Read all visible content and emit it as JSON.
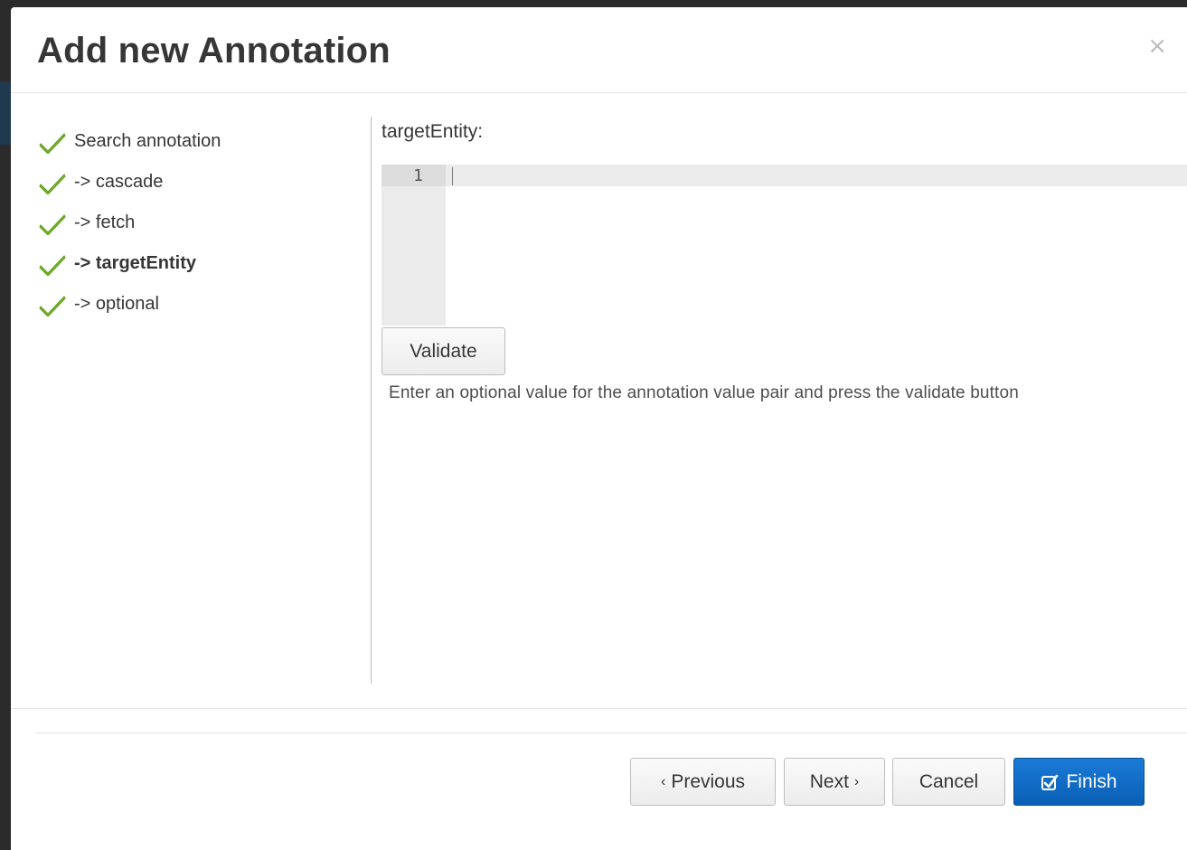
{
  "dialog": {
    "title": "Add new Annotation",
    "close_symbol": "×"
  },
  "steps": [
    {
      "label": "Search annotation",
      "icon": "check-icon",
      "active": false
    },
    {
      "label": "-> cascade",
      "icon": "check-icon",
      "active": false
    },
    {
      "label": "-> fetch",
      "icon": "check-icon",
      "active": false
    },
    {
      "label": "-> targetEntity",
      "icon": "check-icon",
      "active": true
    },
    {
      "label": "-> optional",
      "icon": "check-icon",
      "active": false
    }
  ],
  "content": {
    "field_label": "targetEntity:",
    "editor": {
      "line_number": "1",
      "value": ""
    },
    "validate_label": "Validate",
    "help_text": "Enter an optional value for the annotation value pair and press the validate button"
  },
  "footer": {
    "previous_label": "Previous",
    "next_label": "Next",
    "cancel_label": "Cancel",
    "finish_label": "Finish",
    "previous_chevron": "‹",
    "next_chevron": "›"
  },
  "colors": {
    "check": "#7cbb2b",
    "primary": "#0a65c2",
    "title": "#363636"
  }
}
